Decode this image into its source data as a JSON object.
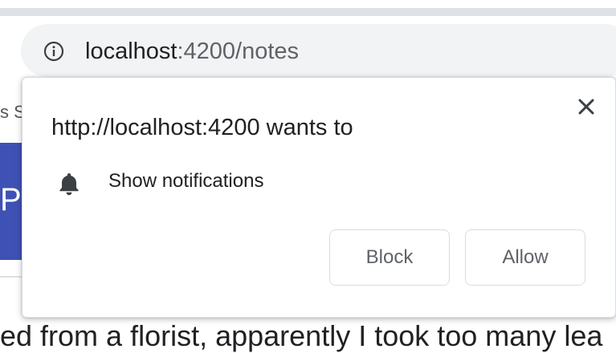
{
  "address_bar": {
    "host": "localhost",
    "rest": ":4200/notes",
    "info_icon": "info-icon"
  },
  "popup": {
    "title": "http://localhost:4200 wants to",
    "permission": {
      "icon": "bell-icon",
      "label": "Show notifications"
    },
    "buttons": {
      "block_label": "Block",
      "allow_label": "Allow"
    },
    "close_icon": "close-icon"
  },
  "page": {
    "fragment_top": "s S",
    "banner_letter": "P",
    "bottom_text": "ed from a florist, apparently I took too many lea"
  },
  "colors": {
    "banner": "#3f51b5",
    "omnibox_bg": "#f1f3f4",
    "tab_bar": "#dee1e6"
  }
}
